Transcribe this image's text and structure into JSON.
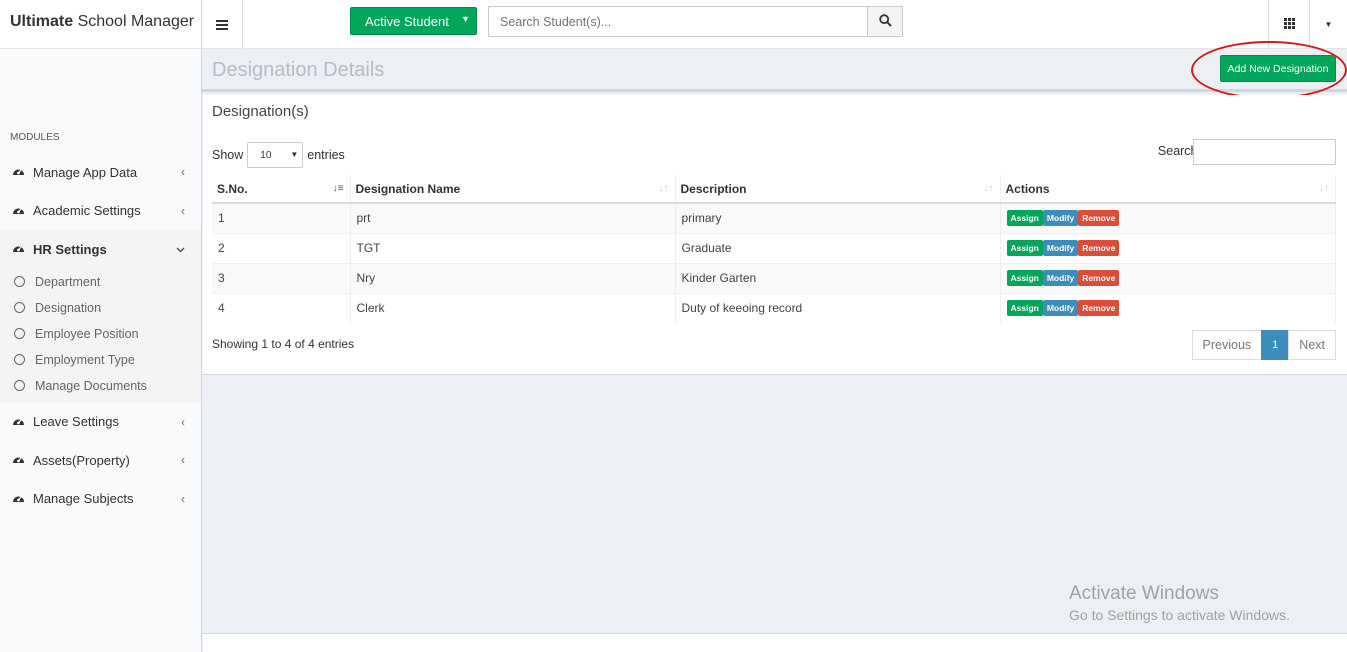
{
  "brand": {
    "bold": "Ultimate",
    "rest": " School Manager"
  },
  "header": {
    "active_student_label": "Active Student",
    "search_placeholder": "Search Student(s)..."
  },
  "sidebar": {
    "modules_label": "MODULES",
    "items": [
      {
        "label": "Manage App Data"
      },
      {
        "label": "Academic Settings"
      },
      {
        "label": "HR Settings",
        "sub": [
          "Department",
          "Designation",
          "Employee Position",
          "Employment Type",
          "Manage Documents"
        ]
      },
      {
        "label": "Leave Settings"
      },
      {
        "label": "Assets(Property)"
      },
      {
        "label": "Manage Subjects"
      }
    ]
  },
  "content": {
    "title": "Designation Details",
    "add_button": "Add New Designation",
    "box_title": "Designation(s)",
    "show_label": "Show",
    "entries_value": "10",
    "entries_label": "entries",
    "search_label": "Search:",
    "columns": [
      "S.No.",
      "Designation Name",
      "Description",
      "Actions"
    ],
    "rows": [
      {
        "sno": "1",
        "name": "prt",
        "desc": "primary"
      },
      {
        "sno": "2",
        "name": "TGT",
        "desc": "Graduate"
      },
      {
        "sno": "3",
        "name": "Nry",
        "desc": "Kinder Garten"
      },
      {
        "sno": "4",
        "name": "Clerk",
        "desc": "Duty of keeoing record"
      }
    ],
    "action_labels": {
      "assign": "Assign",
      "modify": "Modify",
      "remove": "Remove"
    },
    "showing_text": "Showing 1 to 4 of 4 entries",
    "pager": {
      "previous": "Previous",
      "current": "1",
      "next": "Next"
    }
  },
  "watermark": {
    "line1": "Activate Windows",
    "line2": "Go to Settings to activate Windows."
  },
  "colors": {
    "green": "#00a65a",
    "blue": "#3c8dbc",
    "red": "#dd4b39",
    "annotation_ring": "#d31a1a"
  }
}
